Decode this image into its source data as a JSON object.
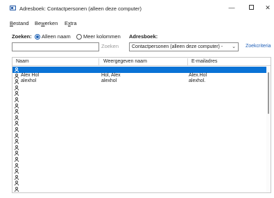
{
  "window": {
    "title": "Adresboek: Contactpersonen (alleen deze computer)",
    "minimize": "—",
    "close": "✕"
  },
  "menu": {
    "items": [
      {
        "pre": "",
        "u": "B",
        "post": "estand"
      },
      {
        "pre": "Be",
        "u": "w",
        "post": "erken"
      },
      {
        "pre": "E",
        "u": "x",
        "post": "tra"
      }
    ]
  },
  "search": {
    "label": "Zoeken:",
    "option_name_only": "Alleen naam",
    "option_more_columns": "Meer kolommen",
    "selected_option": "Alleen naam",
    "addressbook_label": "Adresboek:",
    "input_value": "",
    "search_button": "Zoeken",
    "addressbook_value": "Contactpersonen (alleen deze computer) -",
    "advanced_link": "Zoekcriteria"
  },
  "table": {
    "columns": [
      "Naam",
      "Weergegeven naam",
      "E-mailadres"
    ],
    "selected_row": 0,
    "rows": [
      {
        "name": "",
        "display": "",
        "email": ""
      },
      {
        "name": "Alex Hol",
        "display": "Hol, Alex",
        "email": "Alex.Hol"
      },
      {
        "name": "alexhol",
        "display": "alexhol",
        "email": "alexhol."
      },
      {
        "name": "",
        "display": "",
        "email": ""
      },
      {
        "name": "",
        "display": "",
        "email": ""
      },
      {
        "name": "",
        "display": "",
        "email": ""
      },
      {
        "name": "",
        "display": "",
        "email": ""
      },
      {
        "name": "",
        "display": "",
        "email": ""
      },
      {
        "name": "",
        "display": "",
        "email": ""
      },
      {
        "name": "",
        "display": "",
        "email": ""
      },
      {
        "name": "",
        "display": "",
        "email": ""
      },
      {
        "name": "",
        "display": "",
        "email": ""
      },
      {
        "name": "",
        "display": "",
        "email": ""
      },
      {
        "name": "",
        "display": "",
        "email": ""
      },
      {
        "name": "",
        "display": "",
        "email": ""
      },
      {
        "name": "",
        "display": "",
        "email": ""
      },
      {
        "name": "",
        "display": "",
        "email": ""
      },
      {
        "name": "",
        "display": "",
        "email": ""
      },
      {
        "name": "",
        "display": "",
        "email": ""
      },
      {
        "name": "",
        "display": "",
        "email": ""
      },
      {
        "name": "",
        "display": "",
        "email": ""
      }
    ]
  },
  "colors": {
    "selection": "#0a73d6",
    "link": "#1f5fb8"
  }
}
